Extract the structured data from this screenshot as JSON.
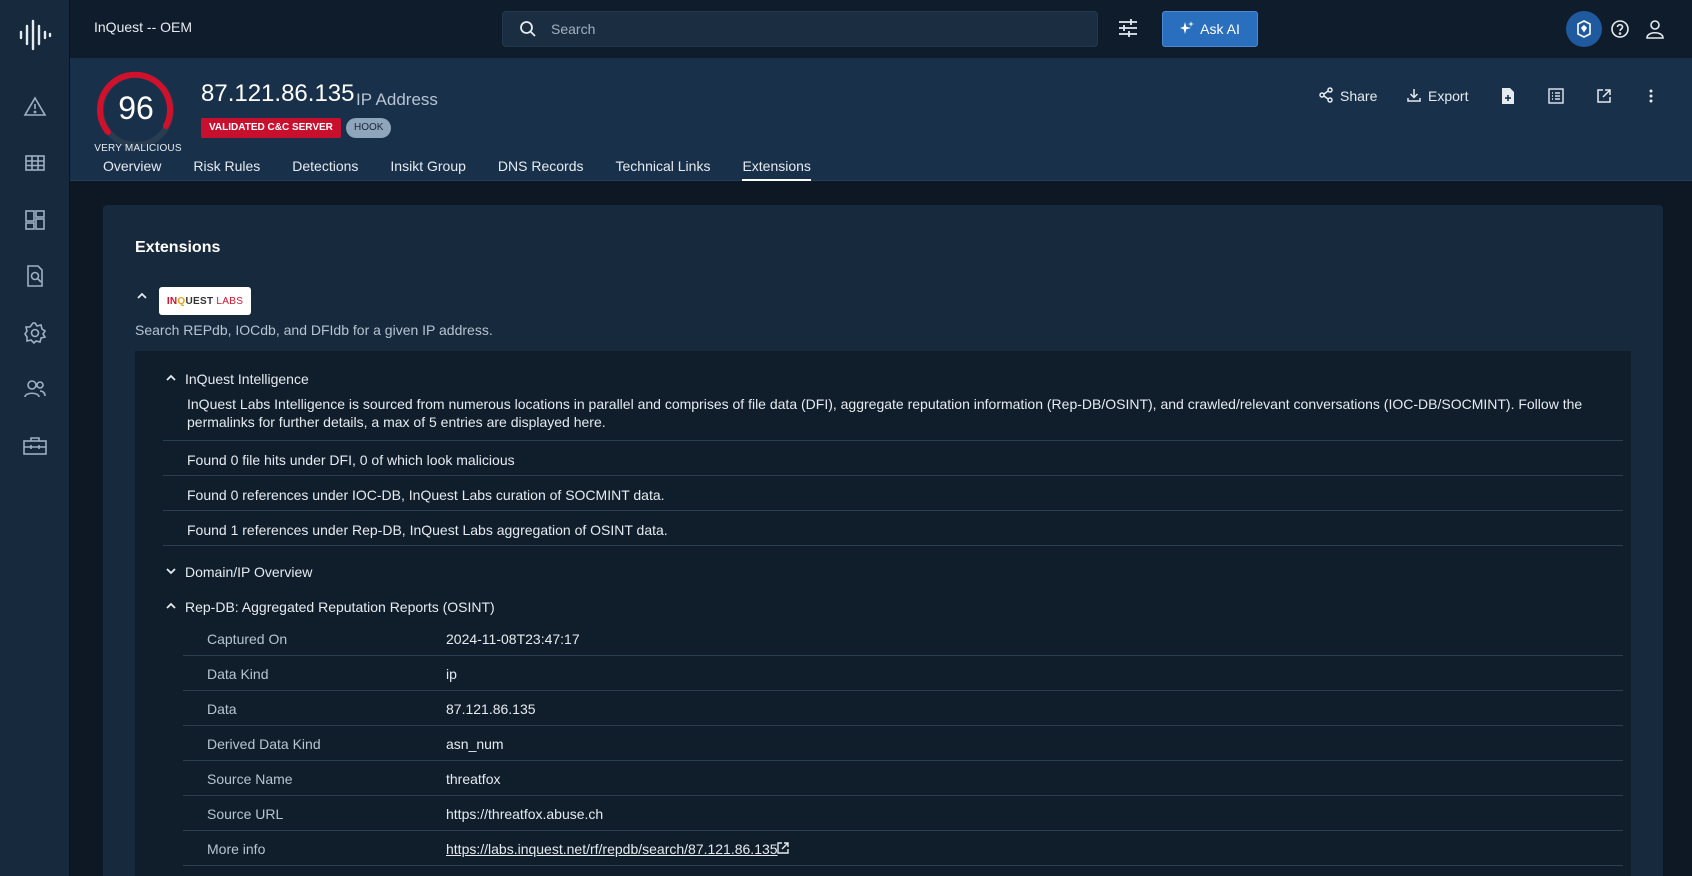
{
  "app": {
    "title": "InQuest -- OEM"
  },
  "search": {
    "placeholder": "Search"
  },
  "ask_ai": {
    "label": "Ask AI"
  },
  "entity": {
    "score": "96",
    "risk_label": "VERY MALICIOUS",
    "name": "87.121.86.135",
    "type": "IP Address",
    "badges": [
      "VALIDATED C&C SERVER",
      "HOOK"
    ],
    "actions": {
      "share": "Share",
      "export": "Export"
    }
  },
  "tabs": [
    "Overview",
    "Risk Rules",
    "Detections",
    "Insikt Group",
    "DNS Records",
    "Technical Links",
    "Extensions"
  ],
  "active_tab": "Extensions",
  "extensions": {
    "title": "Extensions",
    "logo_text": {
      "a": "IN",
      "b": "Q",
      "c": "UEST",
      "d": "LABS"
    },
    "description": "Search REPdb, IOCdb, and DFIdb for a given IP address.",
    "intel": {
      "heading": "InQuest Intelligence",
      "text": "InQuest Labs Intelligence is sourced from numerous locations in parallel and comprises of file data (DFI), aggregate reputation information (Rep-DB/OSINT), and crawled/relevant conversations (IOC-DB/SOCMINT). Follow the permalinks for further details, a max of 5 entries are displayed here.",
      "rows": [
        "Found 0 file hits under DFI, 0 of which look malicious",
        "Found 0 references under IOC-DB, InQuest Labs curation of SOCMINT data.",
        "Found 1 references under Rep-DB, InQuest Labs aggregation of OSINT data."
      ]
    },
    "domain_overview": {
      "heading": "Domain/IP Overview"
    },
    "repdb": {
      "heading": "Rep-DB: Aggregated Reputation Reports (OSINT)",
      "fields": [
        {
          "key": "Captured On",
          "value": "2024-11-08T23:47:17"
        },
        {
          "key": "Data Kind",
          "value": "ip"
        },
        {
          "key": "Data",
          "value": "87.121.86.135"
        },
        {
          "key": "Derived Data Kind",
          "value": "asn_num"
        },
        {
          "key": "Source Name",
          "value": "threatfox"
        },
        {
          "key": "Source URL",
          "value": "https://threatfox.abuse.ch"
        },
        {
          "key": "More info",
          "value": "https://labs.inquest.net/rf/repdb/search/87.121.86.135"
        }
      ]
    }
  },
  "colors": {
    "accent": "#2a6fbd",
    "danger": "#c8102e",
    "background": "#0e1824"
  }
}
